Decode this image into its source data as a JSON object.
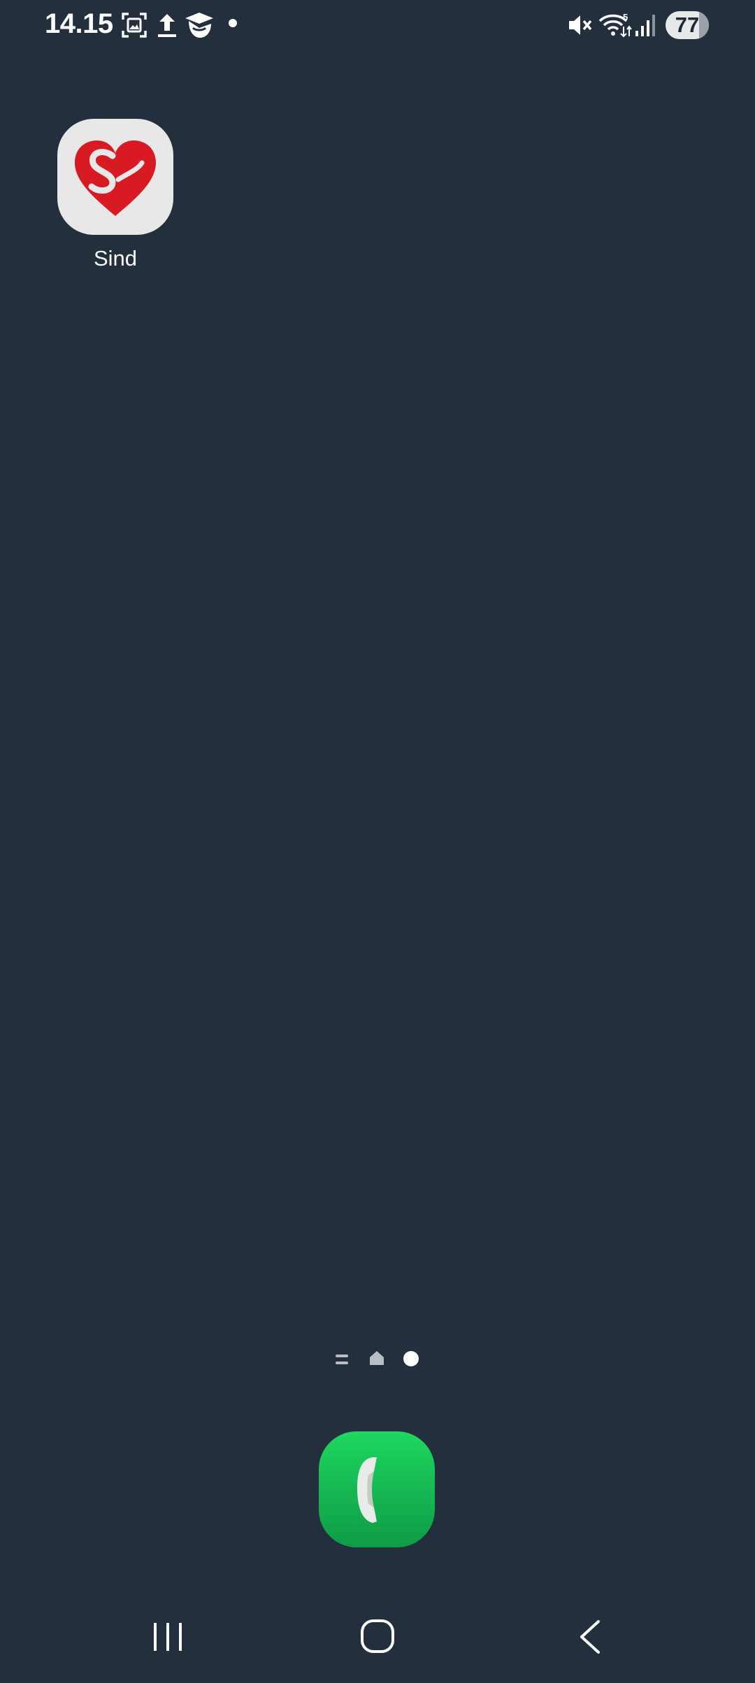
{
  "status_bar": {
    "time": "14.15",
    "battery_level": "77",
    "battery_fraction": 0.77,
    "wifi_badge": "5",
    "icons": [
      "screenshot-icon",
      "upload-icon",
      "app-notification-icon",
      "dot-icon",
      "mute-icon",
      "wifi-icon",
      "signal-icon",
      "battery-icon"
    ]
  },
  "home": {
    "apps": [
      {
        "label": "Sind",
        "icon": "sind-heart-icon"
      }
    ]
  },
  "page_indicator": {
    "items": [
      "menu-page-icon",
      "home-page-icon",
      "current-page-dot"
    ],
    "active": 2
  },
  "dock": {
    "apps": [
      {
        "icon": "phone-icon",
        "color": "#16c15a"
      }
    ]
  },
  "nav_bar": {
    "buttons": [
      "recent-apps-button",
      "home-button",
      "back-button"
    ]
  },
  "colors": {
    "background": "#232f3d",
    "accent_red": "#d81b22"
  }
}
